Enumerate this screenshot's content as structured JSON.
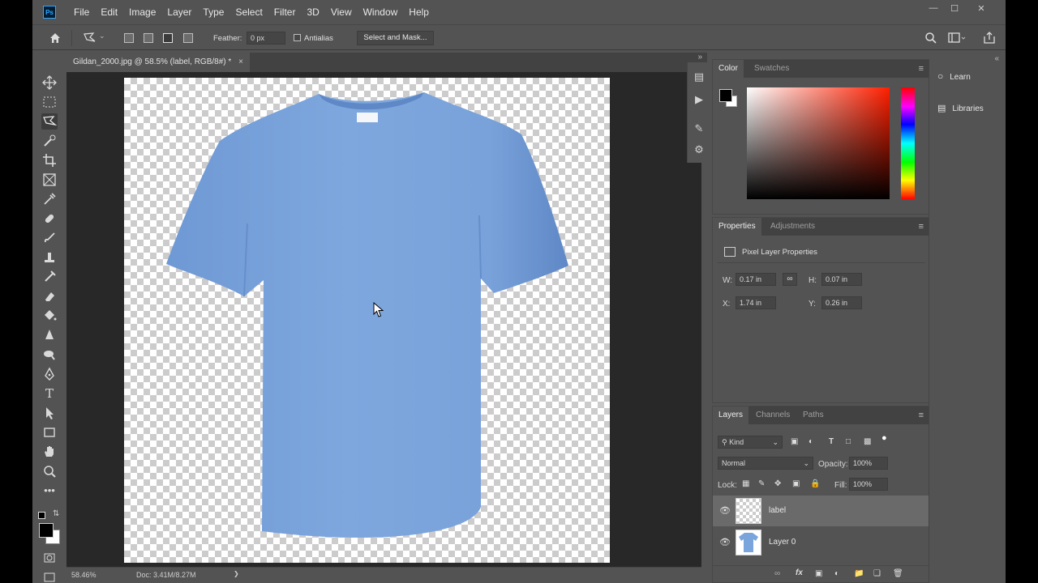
{
  "menu": [
    "File",
    "Edit",
    "Image",
    "Layer",
    "Type",
    "Select",
    "Filter",
    "3D",
    "View",
    "Window",
    "Help"
  ],
  "app_logo": "Ps",
  "window_controls": {
    "minimize": "—",
    "restore": "☐",
    "close": "✕"
  },
  "options": {
    "feather_label": "Feather:",
    "feather_value": "0 px",
    "antialias_label": "Antialias",
    "select_mask_label": "Select and Mask..."
  },
  "document_tab": {
    "title": "Gildan_2000.jpg @ 58.5% (label, RGB/8#) *",
    "close": "×"
  },
  "status": {
    "zoom": "58.46%",
    "doc": "Doc: 3.41M/8.27M",
    "arrow": "❯"
  },
  "color_panel": {
    "tabs": [
      "Color",
      "Swatches"
    ],
    "menu_icon": "≡"
  },
  "properties_panel": {
    "tabs": [
      "Properties",
      "Adjustments"
    ],
    "heading": "Pixel Layer Properties",
    "w_label": "W:",
    "w_value": "0.17 in",
    "h_label": "H:",
    "h_value": "0.07 in",
    "x_label": "X:",
    "x_value": "1.74 in",
    "y_label": "Y:",
    "y_value": "0.26 in"
  },
  "layers_panel": {
    "tabs": [
      "Layers",
      "Channels",
      "Paths"
    ],
    "filter_kind": "Kind",
    "blend_mode": "Normal",
    "opacity_label": "Opacity:",
    "opacity_value": "100%",
    "lock_label": "Lock:",
    "fill_label": "Fill:",
    "fill_value": "100%",
    "layers": [
      {
        "name": "label",
        "selected": true
      },
      {
        "name": "Layer 0",
        "selected": false
      }
    ]
  },
  "right_column": {
    "learn": "Learn",
    "libraries": "Libraries"
  },
  "colors": {
    "shirt": "#7aa4dc",
    "shirt_shadow": "#5e88c6",
    "accent": "#31a8ff"
  }
}
